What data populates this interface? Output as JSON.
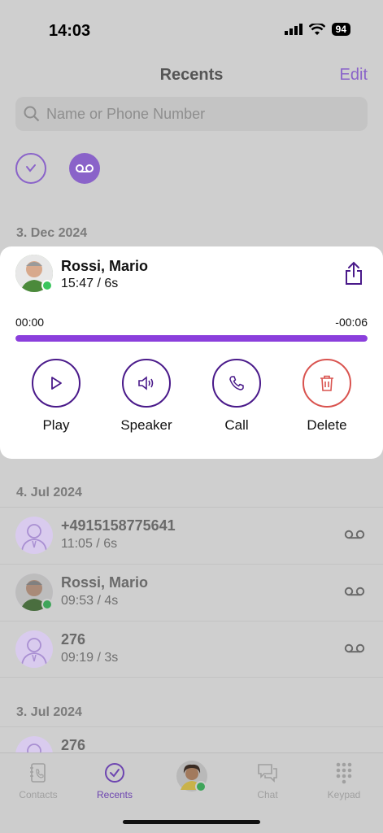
{
  "status": {
    "time": "14:03",
    "battery": "94"
  },
  "header": {
    "title": "Recents",
    "edit": "Edit"
  },
  "search": {
    "placeholder": "Name or Phone Number"
  },
  "colors": {
    "accent": "#8a63c9",
    "progress": "#8b3fdc",
    "delete": "#d9534f",
    "online": "#3ac55d"
  },
  "sections": [
    {
      "date": "3. Dec 2024"
    },
    {
      "date": "4. Jul 2024"
    },
    {
      "date": "3. Jul 2024"
    }
  ],
  "expanded": {
    "name": "Rossi, Mario",
    "meta": "15:47 / 6s",
    "elapsed": "00:00",
    "remaining": "-00:06",
    "progress_fraction": 1.0,
    "actions": {
      "play": "Play",
      "speaker": "Speaker",
      "call": "Call",
      "delete": "Delete"
    }
  },
  "rows": [
    {
      "name": "+4915158775641",
      "meta": "11:05 / 6s",
      "avatar": "default-person-icon"
    },
    {
      "name": "Rossi, Mario",
      "meta": "09:53 / 4s",
      "avatar": "photo"
    },
    {
      "name": "276",
      "meta": "09:19 / 3s",
      "avatar": "default-person-icon"
    },
    {
      "name": "276",
      "meta": "",
      "avatar": "default-person-icon"
    }
  ],
  "tabs": {
    "contacts": "Contacts",
    "recents": "Recents",
    "chat": "Chat",
    "keypad": "Keypad"
  }
}
